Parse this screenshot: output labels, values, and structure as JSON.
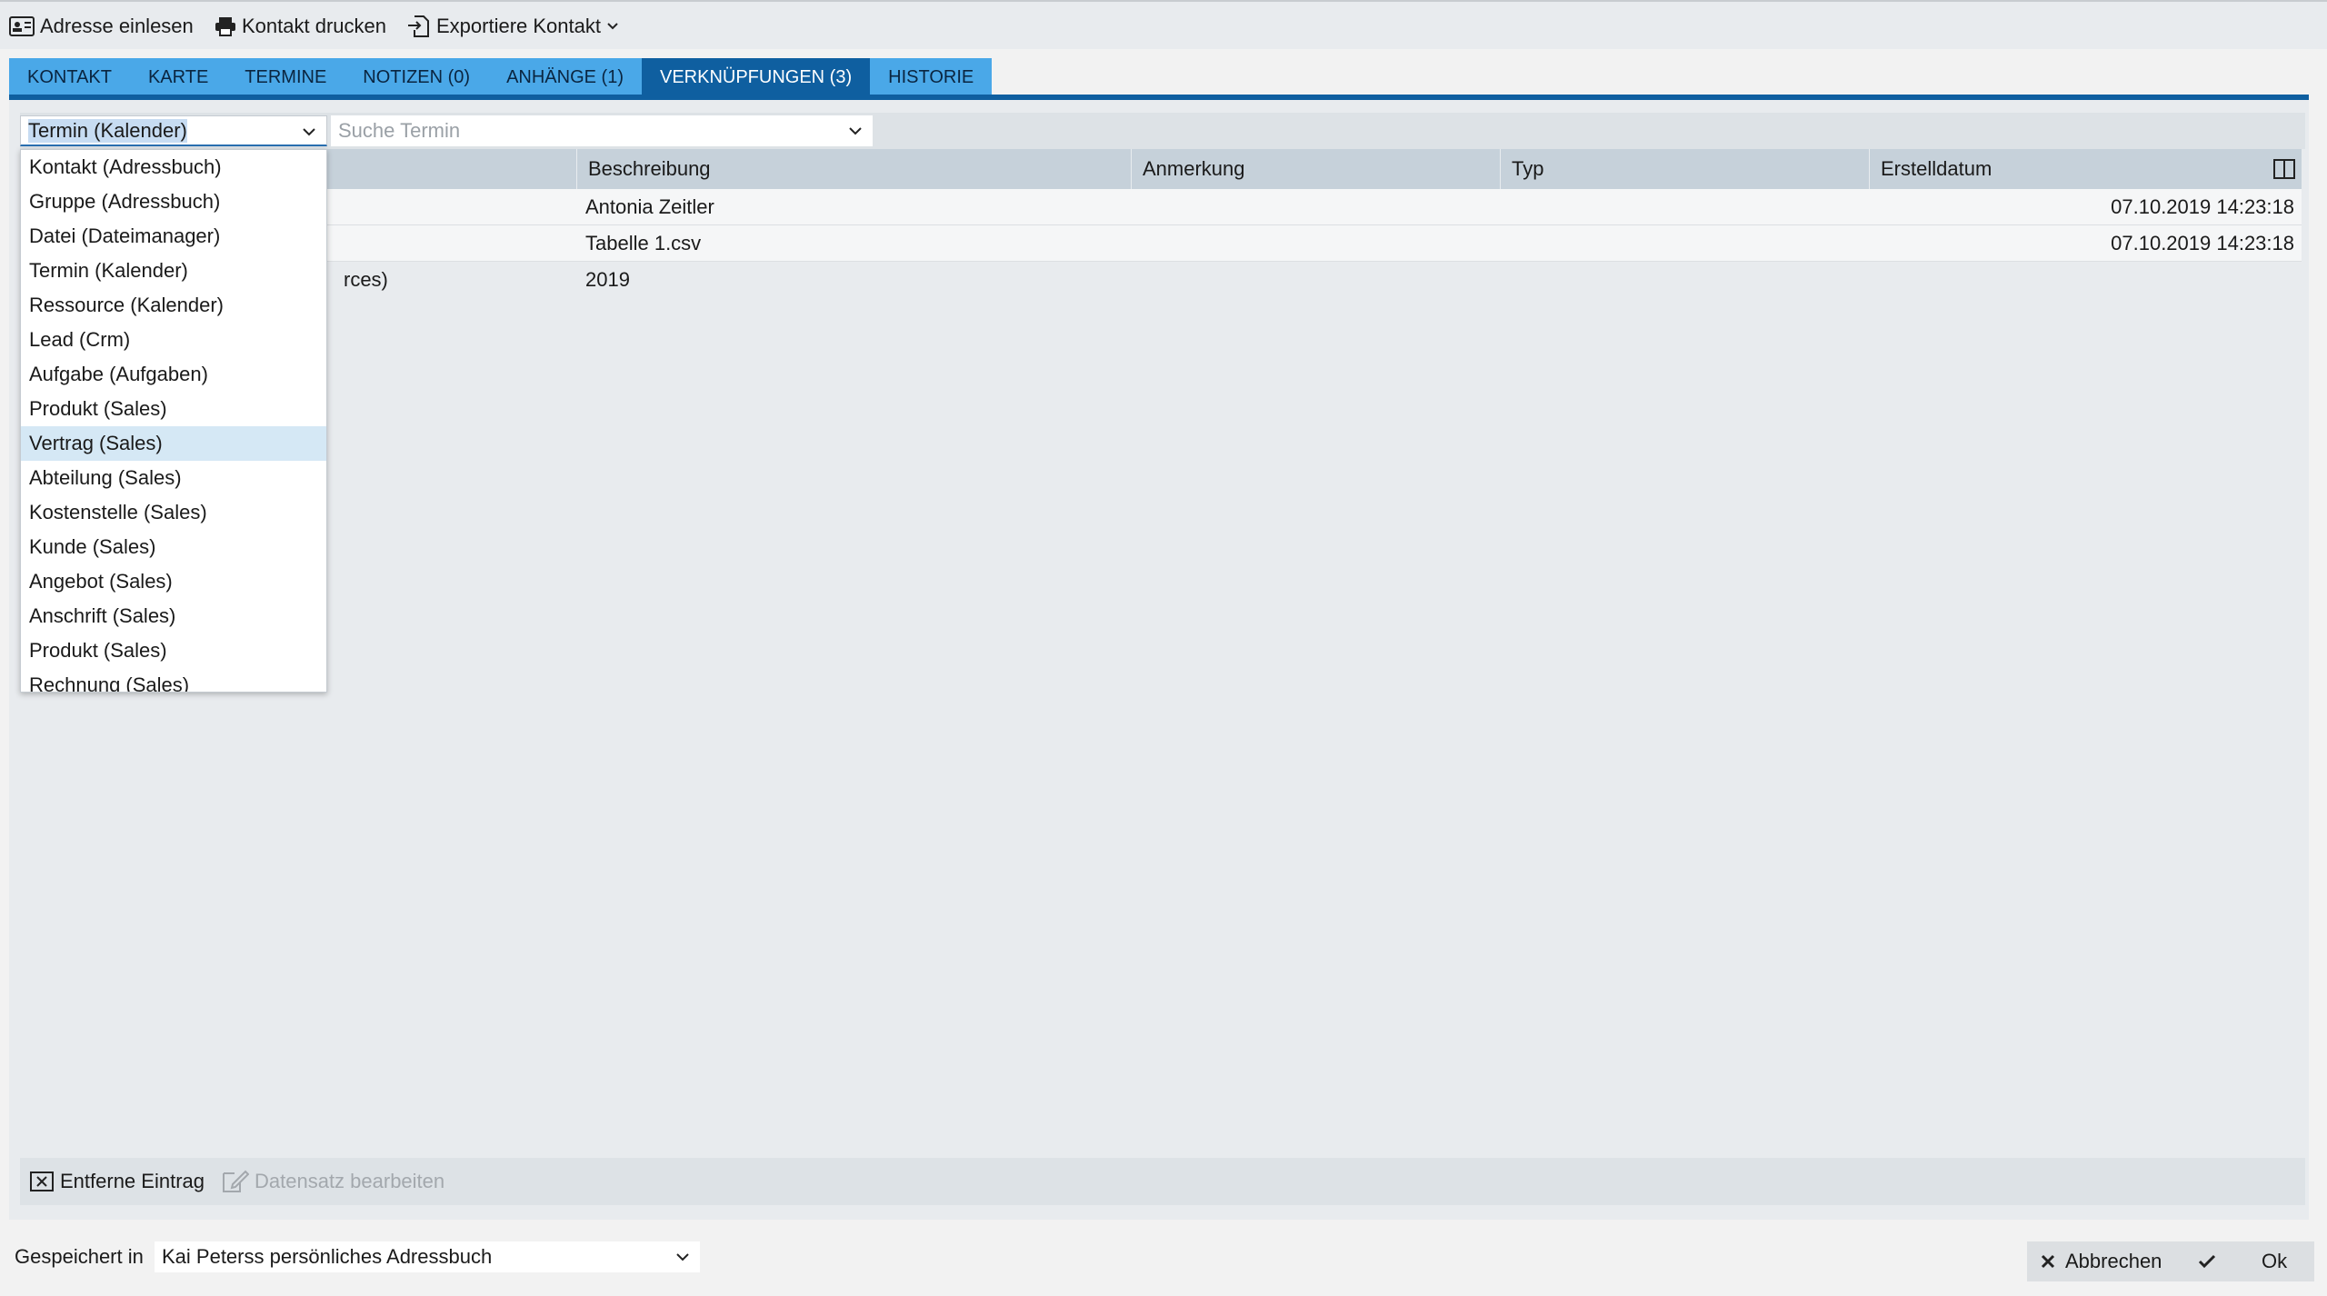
{
  "toolbar": {
    "import_label": "Adresse einlesen",
    "print_label": "Kontakt drucken",
    "export_label": "Exportiere Kontakt"
  },
  "tabs": [
    {
      "label": "KONTAKT"
    },
    {
      "label": "KARTE"
    },
    {
      "label": "TERMINE"
    },
    {
      "label": "NOTIZEN (0)"
    },
    {
      "label": "ANHÄNGE (1)"
    },
    {
      "label": "VERKNÜPFUNGEN (3)"
    },
    {
      "label": "HISTORIE"
    }
  ],
  "active_tab": "VERKNÜPFUNGEN (3)",
  "filter": {
    "type_value": "Termin (Kalender)",
    "search_placeholder": "Suche Termin"
  },
  "grid": {
    "columns": [
      "Beschreibung",
      "Anmerkung",
      "Typ",
      "Erstelldatum"
    ],
    "rows": [
      {
        "type_fragment": "",
        "description": "Antonia Zeitler",
        "note": "",
        "kind": "",
        "created": "07.10.2019 14:23:18"
      },
      {
        "type_fragment": "",
        "description": "Tabelle 1.csv",
        "note": "",
        "kind": "",
        "created": "07.10.2019 14:23:18"
      },
      {
        "type_fragment": "rces)",
        "description": "2019",
        "note": "",
        "kind": "",
        "created": ""
      }
    ]
  },
  "dropdown": {
    "highlighted": "Vertrag (Sales)",
    "options": [
      "Kontakt (Adressbuch)",
      "Gruppe (Adressbuch)",
      "Datei (Dateimanager)",
      "Termin (Kalender)",
      "Ressource (Kalender)",
      "Lead (Crm)",
      "Aufgabe (Aufgaben)",
      "Produkt (Sales)",
      "Vertrag (Sales)",
      "Abteilung (Sales)",
      "Kostenstelle (Sales)",
      "Kunde (Sales)",
      "Angebot (Sales)",
      "Anschrift (Sales)",
      "Produkt (Sales)",
      "Rechnung (Sales)"
    ]
  },
  "actions": {
    "remove_label": "Entferne Eintrag",
    "edit_label": "Datensatz bearbeiten"
  },
  "footer": {
    "saved_in_label": "Gespeichert in",
    "saved_in_value": "Kai Peterss persönliches Adressbuch",
    "cancel_label": "Abbrechen",
    "ok_label": "Ok"
  },
  "colors": {
    "tab": "#4aa8e8",
    "tab_active": "#0f5fa0",
    "highlight": "#d5e8f5"
  }
}
